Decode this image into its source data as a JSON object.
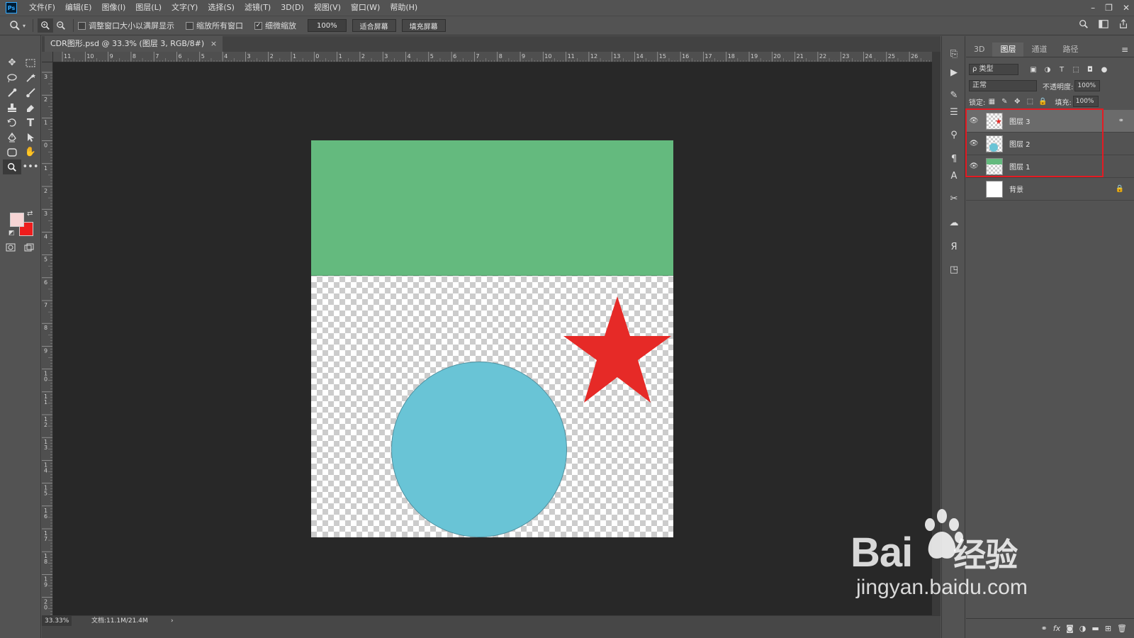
{
  "app": {
    "logo_text": "Ps",
    "menu": [
      "文件(F)",
      "编辑(E)",
      "图像(I)",
      "图层(L)",
      "文字(Y)",
      "选择(S)",
      "滤镜(T)",
      "3D(D)",
      "视图(V)",
      "窗口(W)",
      "帮助(H)"
    ],
    "window_controls": {
      "minimize": "–",
      "restore": "❐",
      "close": "✕"
    }
  },
  "options_bar": {
    "resize_windows_label": "调整窗口大小以满屏显示",
    "resize_windows_checked": false,
    "zoom_all_label": "缩放所有窗口",
    "zoom_all_checked": false,
    "scrubby_zoom_label": "细微缩放",
    "scrubby_zoom_checked": true,
    "zoom_value": "100%",
    "fit_screen_label": "适合屏幕",
    "fill_screen_label": "填充屏幕"
  },
  "document": {
    "tab_title": "CDR图形.psd @ 33.3% (图层 3, RGB/8#)",
    "ruler_h_labels": [
      "11",
      "10",
      "9",
      "8",
      "7",
      "6",
      "5",
      "4",
      "3",
      "2",
      "1",
      "0",
      "1",
      "2",
      "3",
      "4",
      "5",
      "6",
      "7",
      "8",
      "9",
      "10",
      "11",
      "12",
      "13",
      "14",
      "15",
      "16",
      "17",
      "18",
      "19",
      "20",
      "21",
      "22",
      "23",
      "24",
      "25",
      "26",
      "2"
    ],
    "ruler_v_labels": [
      "3",
      "2",
      "1",
      "0",
      "1",
      "2",
      "3",
      "4",
      "5",
      "6",
      "7",
      "8",
      "9",
      "1 0",
      "1 1",
      "1 2",
      "1 3",
      "1 4",
      "1 5",
      "1 6",
      "1 7",
      "1 8",
      "1 9",
      "2 0"
    ],
    "zoom_status": "33.33%",
    "doc_status": "文档:11.1M/21.4M",
    "status_arrow": "›"
  },
  "canvas": {
    "layer1_color": "#64ba7e",
    "layer2_color": "#69c4d6",
    "layer3_color": "#e62a27"
  },
  "layers_panel": {
    "tabs": [
      "3D",
      "图层",
      "通道",
      "路径"
    ],
    "active_tab": "图层",
    "filter_label": "ρ 类型",
    "blend_mode": "正常",
    "opacity_label": "不透明度:",
    "opacity_value": "100%",
    "lock_label": "锁定:",
    "fill_label": "填充:",
    "fill_value": "100%",
    "layers": [
      {
        "name": "图层 3",
        "visible": true,
        "selected": true,
        "thumb": "star"
      },
      {
        "name": "图层 2",
        "visible": true,
        "selected": false,
        "thumb": "circle"
      },
      {
        "name": "图层 1",
        "visible": true,
        "selected": false,
        "thumb": "rect"
      },
      {
        "name": "背景",
        "visible": false,
        "selected": false,
        "thumb": "white"
      }
    ],
    "highlight_color": "#e41b23"
  },
  "watermark": {
    "brand": "Bai",
    "brand_suffix": "经验",
    "url": "jingyan.baidu.com"
  }
}
